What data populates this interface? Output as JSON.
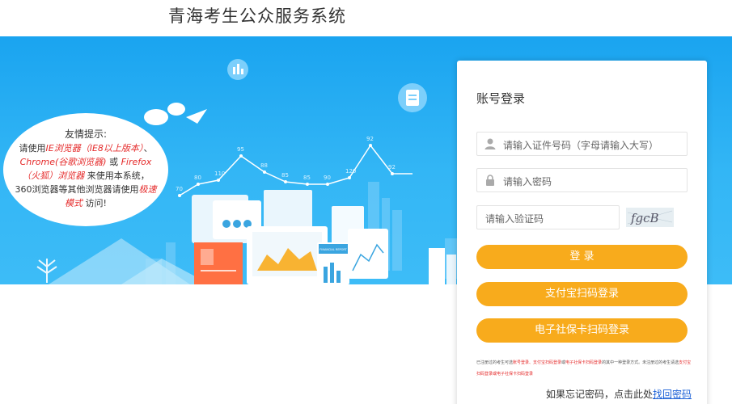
{
  "header": {
    "title": "青海考生公众服务系统"
  },
  "tip": {
    "title": "友情提示:",
    "line1_prefix": "请使用",
    "ie": "IE浏览器（IE8以上版本）",
    "sep": "、",
    "chrome": "Chrome(谷歌浏览器)",
    "or": " 或 ",
    "firefox": "Firefox（火狐）浏览器",
    "mid": " 来使用本系统，360浏览器等其他浏览器请使用",
    "speed": "极速模式",
    "end": " 访问!"
  },
  "chart_labels": [
    "70",
    "80",
    "110",
    "95",
    "88",
    "85",
    "85",
    "90",
    "120",
    "92",
    "92"
  ],
  "report_label": "FINANCIAL REPORT",
  "login": {
    "title": "账号登录",
    "id_placeholder": "请输入证件号码（字母请输入大写）",
    "password_placeholder": "请输入密码",
    "captcha_placeholder": "请输入验证码",
    "captcha_text": "fgcB",
    "login_button": "登 录",
    "alipay_button": "支付宝扫码登录",
    "social_card_button": "电子社保卡扫码登录",
    "notice_part1": "已注册过的考生可选",
    "notice_red1": "账号登录、支付宝扫码登录",
    "notice_part2": "或",
    "notice_red2": "电子社保卡扫码登录",
    "notice_part3": "的其中一种登录方式。未注册过的考生请选",
    "notice_red3": "支付宝扫码登录或电子社保卡扫码登录",
    "forgot_prefix": "如果忘记密码，点击此处",
    "forgot_link": "找回密码"
  },
  "colors": {
    "banner": "#1aa4f0",
    "button": "#f8ab1c",
    "link": "#1a5fd6",
    "red": "#e52b2b"
  }
}
